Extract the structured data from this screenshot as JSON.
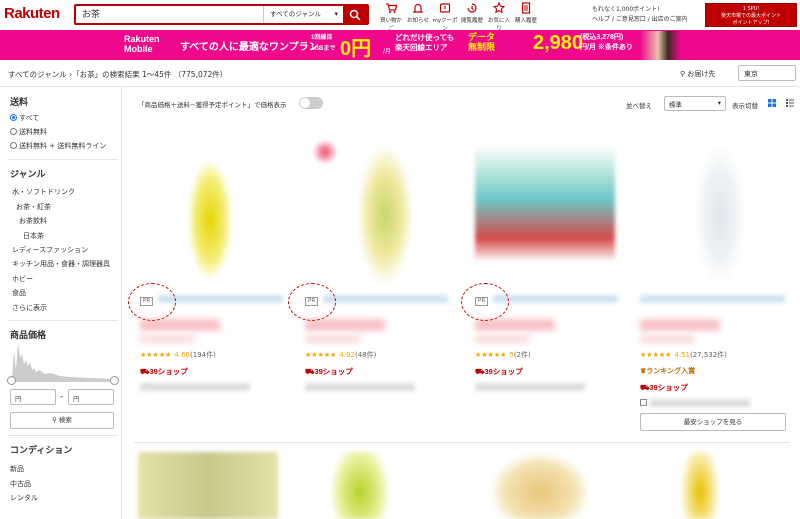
{
  "header": {
    "logo": "Rakuten",
    "search_value": "お茶",
    "category": "すべてのジャンル",
    "nav": [
      "買い物かご",
      "お知らせ",
      "myクーポン",
      "閲覧履歴",
      "お気に入り",
      "購入履歴"
    ],
    "account_line1": "もれなく1,000ポイント!",
    "account_line2": "ヘルプ / ご意見窓口 / 出店のご案内",
    "promo_line1": "1 SPU!",
    "promo_line2": "楽天市場での最大ポイント",
    "promo_line3": "ポイントアップ!"
  },
  "banner": {
    "brand": "Rakuten\nMobile",
    "tagline": "すべての人に最適なワンプラン",
    "data1": "1回線目\n1GBまで",
    "zero": "0円",
    "zero_unit": "/月",
    "unlimited": "どれだけ使っても\n楽天回線エリア",
    "data_unlimited": "データ\n無制限",
    "price": "2,980",
    "price_tax": "(税込3,278円)\n円/月 ※条件あり"
  },
  "breadcrumb": "すべてのジャンル ›「お茶」の検索結果 1〜45件 （775,072件）",
  "delivery": {
    "label": "お届け先",
    "value": "東京"
  },
  "sidebar": {
    "shipping_title": "送料",
    "shipping_options": [
      "すべて",
      "送料無料",
      "送料無料 + 送料無料ライン"
    ],
    "genre_title": "ジャンル",
    "genres": [
      "水・ソフトドリンク",
      "お茶・紅茶",
      "お茶飲料",
      "日本茶",
      "レディースファッション",
      "キッチン用品・食器・調理器具",
      "ホビー",
      "食品",
      "さらに表示"
    ],
    "price_title": "商品価格",
    "price_min_placeholder": "円",
    "price_max_placeholder": "円",
    "price_sep": "-",
    "search_button": "検索",
    "condition_title": "コンディション",
    "conditions": [
      "新品",
      "中古品",
      "レンタル"
    ]
  },
  "toolbar": {
    "toggle_label": "「商品価格＋送料−獲得予定ポイント」で価格表示",
    "sort_label": "並べ替え",
    "sort_value": "標準",
    "view_label": "表示切替"
  },
  "products": [
    {
      "stars": "★★★★★",
      "rating": "4.66",
      "reviews": "(194件)",
      "shop": "39ショップ",
      "pr": "PR"
    },
    {
      "stars": "★★★★★",
      "rating": "4.92",
      "reviews": "(48件)",
      "shop": "39ショップ",
      "pr": "PR"
    },
    {
      "stars": "★★★★★",
      "rating": "5",
      "reviews": "(2件)",
      "shop": "39ショップ",
      "pr": "PR"
    },
    {
      "stars": "★★★★★",
      "rating": "4.51",
      "reviews": "(27,532件)",
      "ranking": "ランキング入賞",
      "shop": "39ショップ",
      "cheapest_button": "最安ショップを見る"
    }
  ],
  "colors": {
    "brand": "#bf0000",
    "banner": "#f0088c",
    "star": "#f4a600"
  }
}
